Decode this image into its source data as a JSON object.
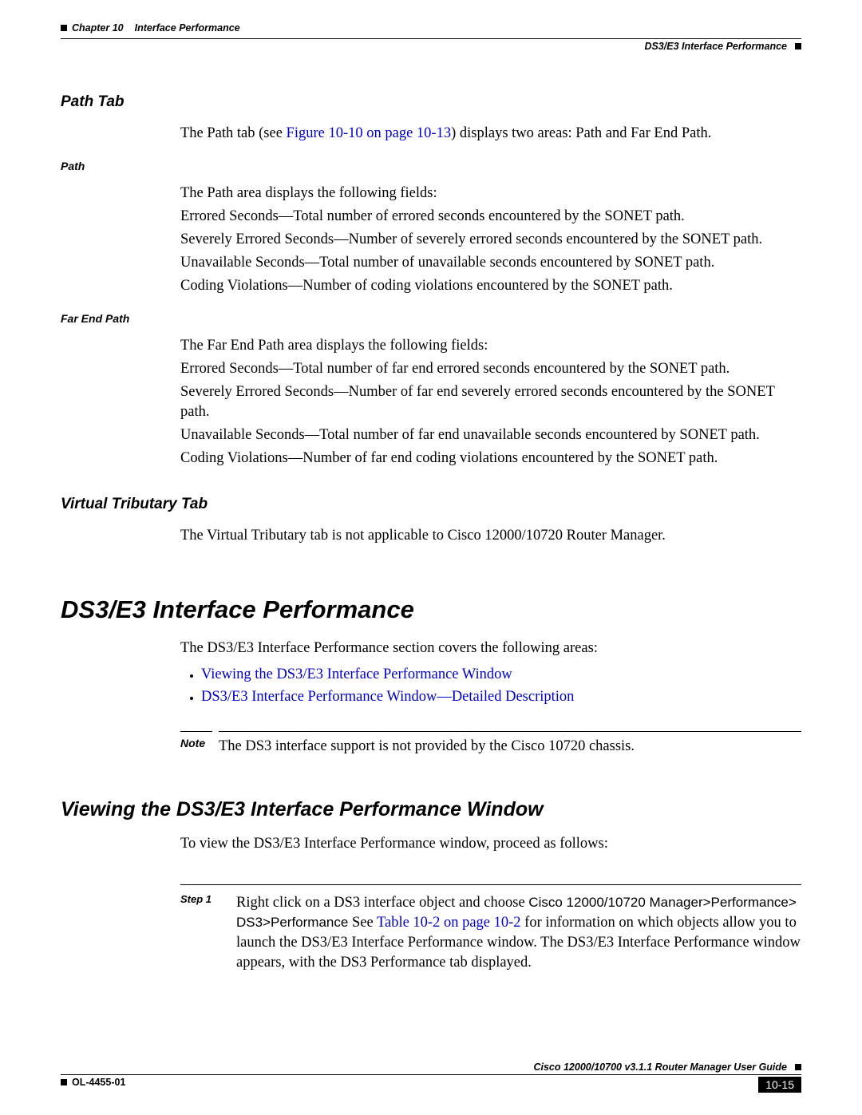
{
  "header": {
    "chapter": "Chapter 10",
    "title": "Interface Performance",
    "subtitle": "DS3/E3 Interface Performance"
  },
  "path_tab": {
    "heading": "Path Tab",
    "intro_before": "The Path tab (see ",
    "intro_link": "Figure 10-10 on page 10-13",
    "intro_after": ") displays two areas: Path and Far End Path.",
    "path": {
      "heading": "Path",
      "intro": "The Path area displays the following fields:",
      "l1": "Errored Seconds—Total number of errored seconds encountered by the SONET path.",
      "l2": "Severely Errored Seconds—Number of severely errored seconds encountered by the SONET path.",
      "l3": "Unavailable Seconds—Total number of unavailable seconds encountered by SONET path.",
      "l4": "Coding Violations—Number of coding violations encountered by the SONET path."
    },
    "far_end": {
      "heading": "Far End Path",
      "intro": "The Far End Path area displays the following fields:",
      "l1": "Errored Seconds—Total number of far end errored seconds encountered by the SONET path.",
      "l2": "Severely Errored Seconds—Number of far end severely errored seconds encountered by the SONET path.",
      "l3": "Unavailable Seconds—Total number of far end unavailable seconds encountered by SONET path.",
      "l4": "Coding Violations—Number of far end coding violations encountered by the SONET path."
    }
  },
  "vt_tab": {
    "heading": "Virtual Tributary Tab",
    "text": "The Virtual Tributary tab is not applicable to Cisco 12000/10720 Router Manager."
  },
  "ds3": {
    "heading": "DS3/E3 Interface Performance",
    "intro": "The DS3/E3 Interface Performance section covers the following areas:",
    "bullet1": "Viewing the DS3/E3 Interface Performance Window",
    "bullet2": "DS3/E3 Interface Performance Window—Detailed Description",
    "note_label": "Note",
    "note_text": "The DS3 interface support is not provided by the Cisco 10720 chassis."
  },
  "viewing": {
    "heading": "Viewing the DS3/E3 Interface Performance Window",
    "intro": "To view the DS3/E3 Interface Performance window, proceed as follows:",
    "step_label": "Step 1",
    "step_t1": "Right click on a DS3 interface object and choose ",
    "step_sans": "Cisco 12000/10720 Manager>Performance> DS3>Performance",
    "step_t2a": " See ",
    "step_link": "Table 10-2 on page 10-2",
    "step_t2b": " for information on which objects allow you to launch the DS3/E3 Interface Performance window. The DS3/E3 Interface Performance window appears, with the DS3 Performance tab displayed."
  },
  "footer": {
    "guide": "Cisco 12000/10700 v3.1.1 Router Manager User Guide",
    "doc_id": "OL-4455-01",
    "page": "10-15"
  }
}
